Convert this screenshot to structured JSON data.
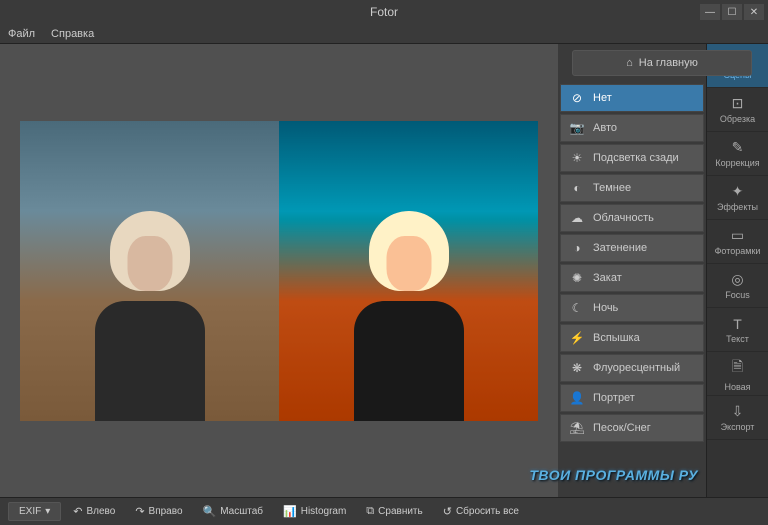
{
  "app": {
    "title": "Fotor"
  },
  "menu": {
    "file": "Файл",
    "help": "Справка"
  },
  "home_button": "На главную",
  "scenes": [
    {
      "icon": "⊘",
      "label": "Нет",
      "active": true
    },
    {
      "icon": "📷",
      "label": "Авто"
    },
    {
      "icon": "☀",
      "label": "Подсветка сзади"
    },
    {
      "icon": "◐",
      "label": "Темнее"
    },
    {
      "icon": "☁",
      "label": "Облачность"
    },
    {
      "icon": "◑",
      "label": "Затенение"
    },
    {
      "icon": "✺",
      "label": "Закат"
    },
    {
      "icon": "☾",
      "label": "Ночь"
    },
    {
      "icon": "⚡",
      "label": "Вспышка"
    },
    {
      "icon": "❋",
      "label": "Флуоресцентный"
    },
    {
      "icon": "👤",
      "label": "Портрет"
    },
    {
      "icon": "⛱",
      "label": "Песок/Снег"
    }
  ],
  "tools": [
    {
      "icon": "☀",
      "label": "Сцены",
      "active": true
    },
    {
      "icon": "⊡",
      "label": "Обрезка"
    },
    {
      "icon": "✎",
      "label": "Коррекция"
    },
    {
      "icon": "✦",
      "label": "Эффекты"
    },
    {
      "icon": "▭",
      "label": "Фоторамки"
    },
    {
      "icon": "◎",
      "label": "Focus"
    },
    {
      "icon": "T",
      "label": "Текст"
    },
    {
      "icon": "🗎",
      "label": "Новая"
    },
    {
      "icon": "⇩",
      "label": "Экспорт"
    }
  ],
  "toolbar": {
    "exif": "EXIF",
    "left": "Влево",
    "right": "Вправо",
    "zoom": "Масштаб",
    "histogram": "Histogram",
    "compare": "Сравнить",
    "reset": "Сбросить все"
  },
  "watermark": "ТВОИ ПРОГРАММЫ РУ"
}
